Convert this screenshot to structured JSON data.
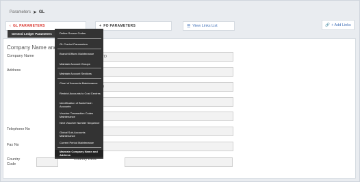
{
  "breadcrumb": {
    "parent": "Parameters",
    "separator": "➤",
    "current": "GL"
  },
  "tabs": {
    "gl": {
      "chevron": "‹",
      "label": "GL PARAMETERS"
    },
    "fo": {
      "chevron": "+",
      "label": "FO PARAMETERS"
    },
    "links": {
      "icon": "list-icon",
      "glyph": "☰",
      "label": "View Links List"
    }
  },
  "add_links": {
    "icon": "add-link-icon",
    "glyph": "🔗",
    "label": "+ Add Links"
  },
  "form": {
    "section_title": "Company Name and A",
    "company_name_label": "Company Name",
    "company_name_value": "LTD",
    "address_label": "Address",
    "address_line3_value": "00",
    "telephone_label": "Telephone No",
    "fax_label": "Fax No",
    "country_code_label": "Country Code",
    "country_desc_label": "Country Desc"
  },
  "menu": {
    "header": "General Ledger Parameters",
    "items": [
      "Define Source Codes",
      "GL Control Parameters",
      "Branch/Offices Maintenance",
      "Maintain Account Groups",
      "Maintain Account Sections",
      "Chart of Accounts Maintenance",
      "Restrict Accounts to Cost Centres",
      "Identification of Bank/Cash Accounts",
      "Voucher Transaction Codes Maintenance",
      "Next Voucher Number Sequence",
      "Global Sub-Accounts Maintenance",
      "Current Period Maintenance",
      "Maintain Company Name and Address"
    ]
  }
}
